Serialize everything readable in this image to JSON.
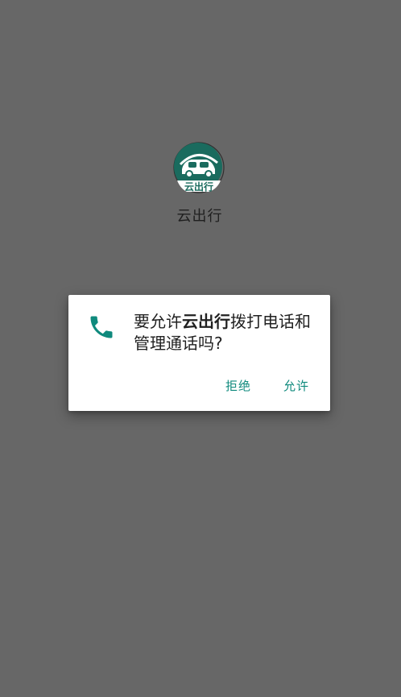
{
  "app": {
    "name": "云出行",
    "logo_text": "云出行",
    "brand_color": "#1a6b5e"
  },
  "dialog": {
    "icon": "phone-icon",
    "message_prefix": "要允许",
    "message_app": "云出行",
    "message_suffix": "拨打电话和管理通话吗?",
    "deny_label": "拒绝",
    "allow_label": "允许",
    "accent_color": "#0f8a7d"
  },
  "colors": {
    "overlay_background": "#676767",
    "dialog_background": "#ffffff"
  }
}
